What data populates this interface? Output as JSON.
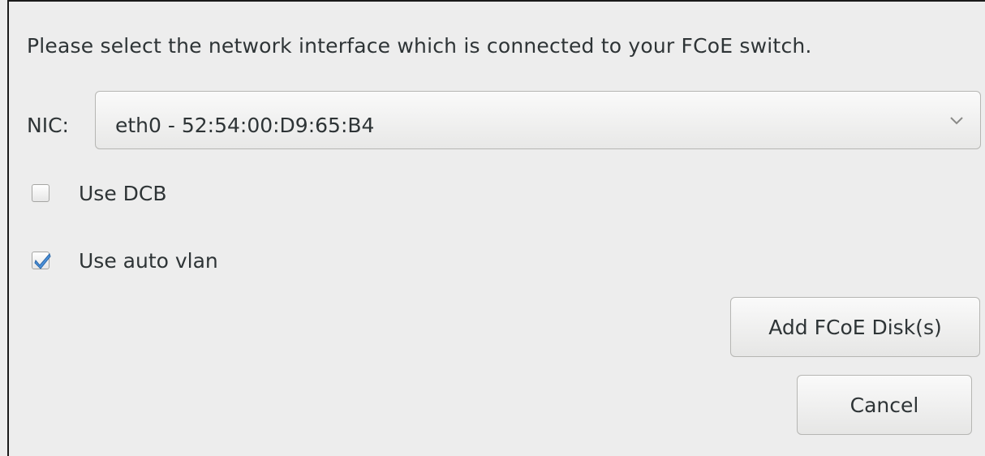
{
  "dialog": {
    "prompt": "Please select the network interface which is connected to your FCoE switch.",
    "nic": {
      "label": "NIC:",
      "selected": "eth0 - 52:54:00:D9:65:B4"
    },
    "options": {
      "use_dcb": {
        "label": "Use DCB",
        "checked": false
      },
      "use_auto_vlan": {
        "label": "Use auto vlan",
        "checked": true
      }
    },
    "buttons": {
      "add_label": "Add FCoE Disk(s)",
      "cancel_label": "Cancel"
    }
  },
  "icons": {
    "combo_arrow": "chevron-down-icon",
    "checkmark": "checkmark-icon"
  },
  "colors": {
    "background": "#ededed",
    "text": "#2e3436",
    "check_accent": "#4a90d9"
  }
}
